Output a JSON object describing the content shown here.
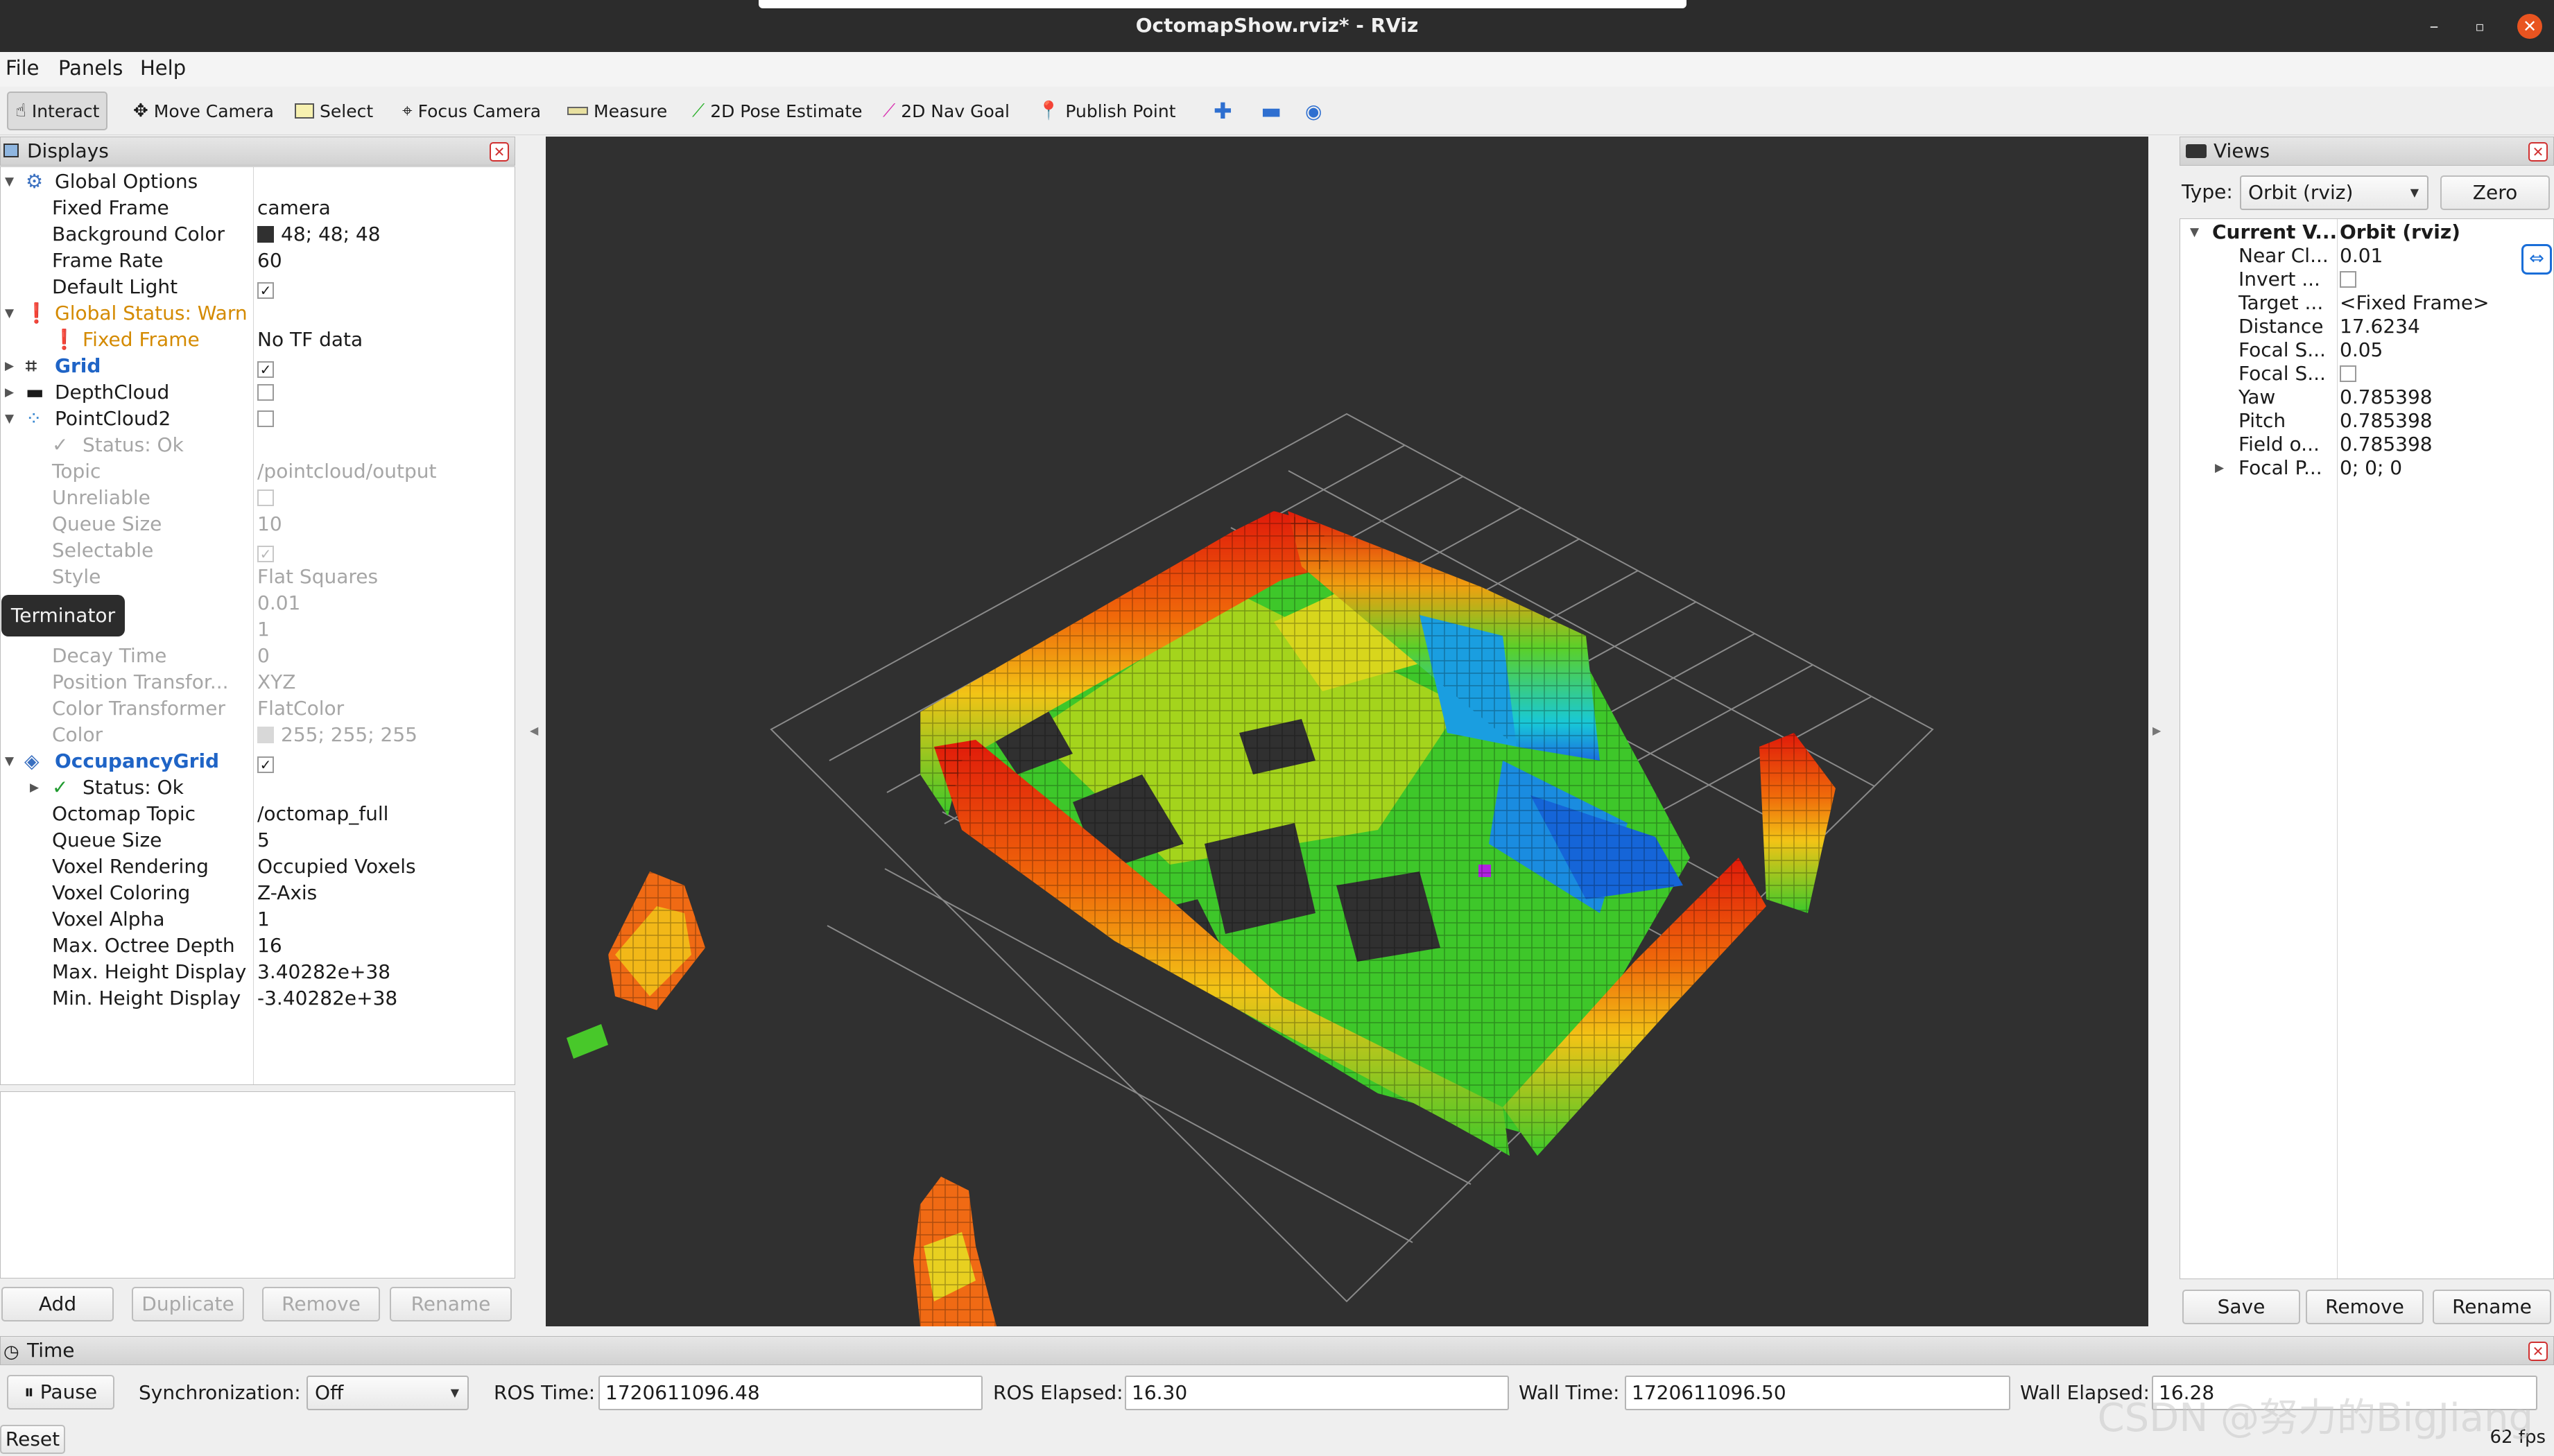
{
  "window": {
    "title": "OctomapShow.rviz* - RViz",
    "controls": [
      "–",
      "▫",
      "✕"
    ]
  },
  "menu": [
    "File",
    "Panels",
    "Help"
  ],
  "toolbar": {
    "interact": "Interact",
    "move_camera": "Move Camera",
    "select": "Select",
    "focus_camera": "Focus Camera",
    "measure": "Measure",
    "pose_estimate": "2D Pose Estimate",
    "nav_goal": "2D Nav Goal",
    "publish_point": "Publish Point"
  },
  "displays": {
    "title": "Displays",
    "rows": [
      {
        "name": "Global Options"
      },
      {
        "name": "Fixed Frame",
        "value": "camera"
      },
      {
        "name": "Background Color",
        "value": "48; 48; 48"
      },
      {
        "name": "Frame Rate",
        "value": "60"
      },
      {
        "name": "Default Light",
        "value": "✓"
      },
      {
        "name": "Global Status: Warn"
      },
      {
        "name": "Fixed Frame",
        "value": "No TF data"
      },
      {
        "name": "Grid",
        "value": "✓"
      },
      {
        "name": "DepthCloud",
        "value": ""
      },
      {
        "name": "PointCloud2",
        "value": ""
      },
      {
        "name": "Status: Ok"
      },
      {
        "name": "Topic",
        "value": "/pointcloud/output"
      },
      {
        "name": "Unreliable",
        "value": ""
      },
      {
        "name": "Queue Size",
        "value": "10"
      },
      {
        "name": "Selectable",
        "value": "✓"
      },
      {
        "name": "Style",
        "value": "Flat Squares"
      },
      {
        "name": "",
        "value": "0.01"
      },
      {
        "name": "",
        "value": "1"
      },
      {
        "name": "Decay Time",
        "value": "0"
      },
      {
        "name": "Position Transfor...",
        "value": "XYZ"
      },
      {
        "name": "Color Transformer",
        "value": "FlatColor"
      },
      {
        "name": "Color",
        "value": "255; 255; 255"
      },
      {
        "name": "OccupancyGrid",
        "value": "✓"
      },
      {
        "name": "Status: Ok"
      },
      {
        "name": "Octomap Topic",
        "value": "/octomap_full"
      },
      {
        "name": "Queue Size",
        "value": "5"
      },
      {
        "name": "Voxel Rendering",
        "value": "Occupied Voxels"
      },
      {
        "name": "Voxel Coloring",
        "value": "Z-Axis"
      },
      {
        "name": "Voxel Alpha",
        "value": "1"
      },
      {
        "name": "Max. Octree Depth",
        "value": "16"
      },
      {
        "name": "Max. Height Display",
        "value": "3.40282e+38"
      },
      {
        "name": "Min. Height Display",
        "value": "-3.40282e+38"
      }
    ],
    "buttons": {
      "add": "Add",
      "duplicate": "Duplicate",
      "remove": "Remove",
      "rename": "Rename"
    },
    "tooltip": "Terminator"
  },
  "views": {
    "title": "Views",
    "type_label": "Type:",
    "type_value": "Orbit (rviz)",
    "zero": "Zero",
    "header": {
      "name": "Current V...",
      "value": "Orbit (rviz)"
    },
    "rows": [
      {
        "name": "Near Cl...",
        "value": "0.01"
      },
      {
        "name": "Invert ...",
        "value": ""
      },
      {
        "name": "Target ...",
        "value": "<Fixed Frame>"
      },
      {
        "name": "Distance",
        "value": "17.6234"
      },
      {
        "name": "Focal S...",
        "value": "0.05"
      },
      {
        "name": "Focal S...",
        "value": ""
      },
      {
        "name": "Yaw",
        "value": "0.785398"
      },
      {
        "name": "Pitch",
        "value": "0.785398"
      },
      {
        "name": "Field o...",
        "value": "0.785398"
      },
      {
        "name": "Focal P...",
        "value": "0; 0; 0"
      }
    ],
    "buttons": {
      "save": "Save",
      "remove": "Remove",
      "rename": "Rename"
    }
  },
  "time": {
    "title": "Time",
    "pause": "Pause",
    "sync_label": "Synchronization:",
    "sync_value": "Off",
    "ros_time_label": "ROS Time:",
    "ros_time": "1720611096.48",
    "ros_elapsed_label": "ROS Elapsed:",
    "ros_elapsed": "16.30",
    "wall_time_label": "Wall Time:",
    "wall_time": "1720611096.50",
    "wall_elapsed_label": "Wall Elapsed:",
    "wall_elapsed": "16.28",
    "reset": "Reset",
    "fps": "62 fps"
  },
  "watermark": "CSDN @努力的BigJiang",
  "colors": {
    "background": "#303030",
    "grid": "#8a8a8a",
    "warn": "#d48a00",
    "link": "#1f64c6"
  }
}
